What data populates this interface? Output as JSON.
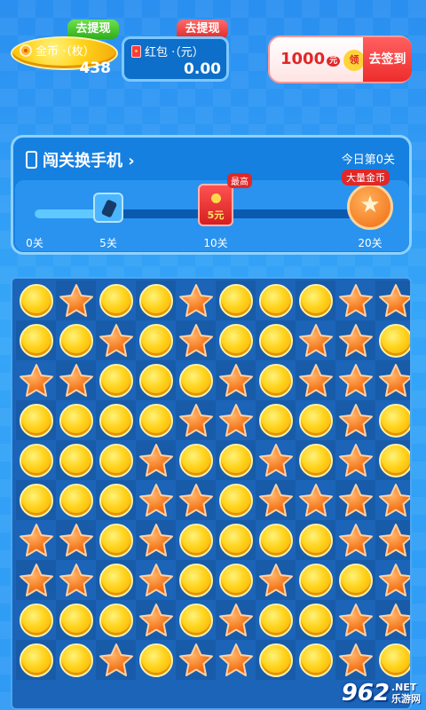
{
  "wallet": {
    "coin": {
      "tag": "去提现",
      "label": "金币 ·（枚）",
      "value": "438"
    },
    "red": {
      "tag": "去提现",
      "label": "红包 ·（元）",
      "value": "0.00"
    }
  },
  "sign": {
    "amount": "1000",
    "unit": "元",
    "ling": "领",
    "action": "去签到"
  },
  "level_panel": {
    "title": "闯关换手机 ›",
    "today": "今日第0关",
    "progress_ratio": 0.2,
    "ticks": [
      "0关",
      "5关",
      "10关",
      "20关"
    ],
    "reward_red": "5元",
    "badge_top": "最高",
    "badge_big": "大量金币"
  },
  "board": {
    "rows": [
      [
        "C",
        "S",
        "C",
        "C",
        "S",
        "C",
        "C",
        "C",
        "S",
        "S"
      ],
      [
        "C",
        "C",
        "S",
        "C",
        "S",
        "C",
        "C",
        "S",
        "S",
        "C"
      ],
      [
        "S",
        "S",
        "C",
        "C",
        "C",
        "S",
        "C",
        "S",
        "S",
        "S"
      ],
      [
        "C",
        "C",
        "C",
        "C",
        "S",
        "S",
        "C",
        "C",
        "S",
        "C"
      ],
      [
        "C",
        "C",
        "C",
        "S",
        "C",
        "C",
        "S",
        "C",
        "S",
        "C"
      ],
      [
        "C",
        "C",
        "C",
        "S",
        "S",
        "C",
        "S",
        "S",
        "S",
        "S"
      ],
      [
        "S",
        "S",
        "C",
        "S",
        "C",
        "C",
        "C",
        "C",
        "S",
        "S"
      ],
      [
        "S",
        "S",
        "C",
        "S",
        "C",
        "C",
        "S",
        "C",
        "C",
        "S"
      ],
      [
        "C",
        "C",
        "C",
        "S",
        "C",
        "S",
        "C",
        "C",
        "S",
        "S"
      ],
      [
        "C",
        "C",
        "S",
        "C",
        "S",
        "S",
        "C",
        "C",
        "S",
        "C"
      ]
    ]
  },
  "watermark": {
    "big": "962",
    "line1": ".NET",
    "line2": "乐游网"
  }
}
